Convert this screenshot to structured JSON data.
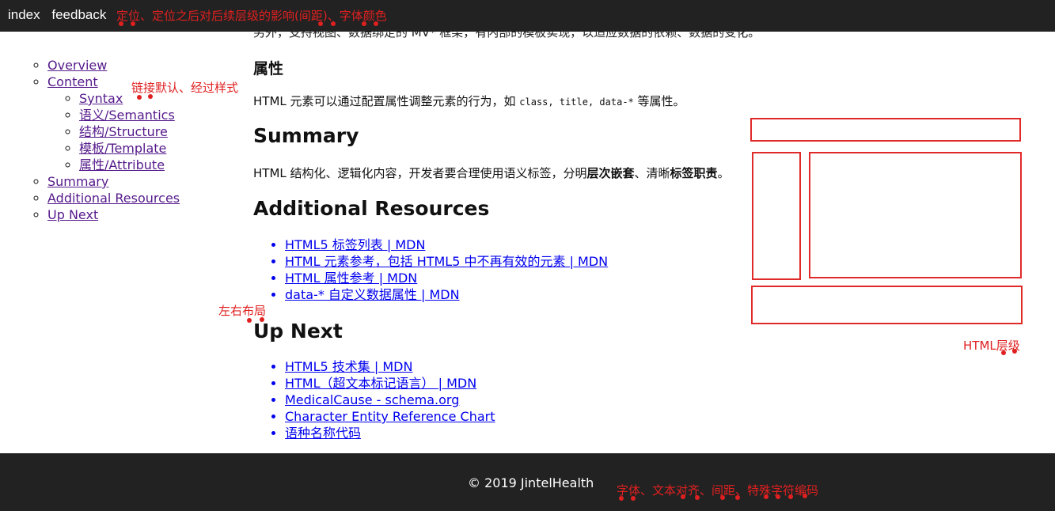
{
  "nav": {
    "items": [
      "index",
      "feedback"
    ]
  },
  "annotations": {
    "positioning": "定位、定位之后对后续层级的影响(间距)、字体颜色",
    "link_styles": "链接默认、经过样式",
    "layout": "左右布局",
    "html_layers": "HTML层级",
    "footer_notes": "字体、文本对齐、间距、特殊字符编码"
  },
  "sidebar": {
    "items": [
      {
        "label": "Overview"
      },
      {
        "label": "Content",
        "children": [
          {
            "label": "Syntax"
          },
          {
            "label": "语义/Semantics"
          },
          {
            "label": "结构/Structure"
          },
          {
            "label": "模板/Template"
          },
          {
            "label": "属性/Attribute"
          }
        ]
      },
      {
        "label": "Summary"
      },
      {
        "label": "Additional Resources"
      },
      {
        "label": "Up Next"
      }
    ]
  },
  "main": {
    "cut_text": "另外，支持视图、数据绑定的 MV* 框架，有内部的模板实现，以适应数据的依赖、数据的变化。",
    "attr_heading": "属性",
    "attr_text_pre": "HTML 元素可以通过配置属性调整元素的行为，如 ",
    "attr_code": "class, title, data-*",
    "attr_text_post": " 等属性。",
    "summary_heading": "Summary",
    "summary_pre": "HTML 结构化、逻辑化内容，开发者要合理使用语义标签，分明",
    "summary_bold1": "层次嵌套",
    "summary_mid": "、清晰",
    "summary_bold2": "标签职责",
    "summary_end": "。",
    "resources_heading": "Additional Resources",
    "resources": [
      "HTML5 标签列表 | MDN",
      "HTML 元素参考，包括 HTML5 中不再有效的元素 | MDN",
      "HTML 属性参考 | MDN",
      "data-* 自定义数据属性 | MDN"
    ],
    "upnext_heading": "Up Next",
    "upnext": [
      "HTML5 技术集 | MDN",
      "HTML（超文本标记语言） | MDN",
      "MedicalCause - schema.org",
      "Character Entity Reference Chart",
      "语种名称代码"
    ]
  },
  "footer": {
    "copyright": "© 2019 JintelHealth"
  },
  "colors": {
    "bar": "#222222",
    "annotation": "#e02020",
    "link": "#0000ee",
    "visited": "#551a8b"
  }
}
